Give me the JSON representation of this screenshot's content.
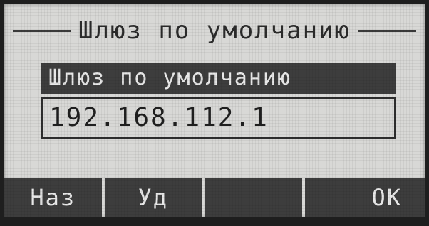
{
  "screen": {
    "title": "Шлюз по умолчанию"
  },
  "field": {
    "label": "Шлюз по умолчанию",
    "value": "192.168.112.1"
  },
  "softkeys": [
    {
      "label": "Наз"
    },
    {
      "label": "Уд"
    },
    {
      "label": ""
    },
    {
      "label": "OK"
    }
  ],
  "colors": {
    "lcd_background": "#d8d8d6",
    "inverted_background": "#3d3d3d",
    "inverted_text": "#e8e8e8",
    "text": "#2b2b2b"
  }
}
